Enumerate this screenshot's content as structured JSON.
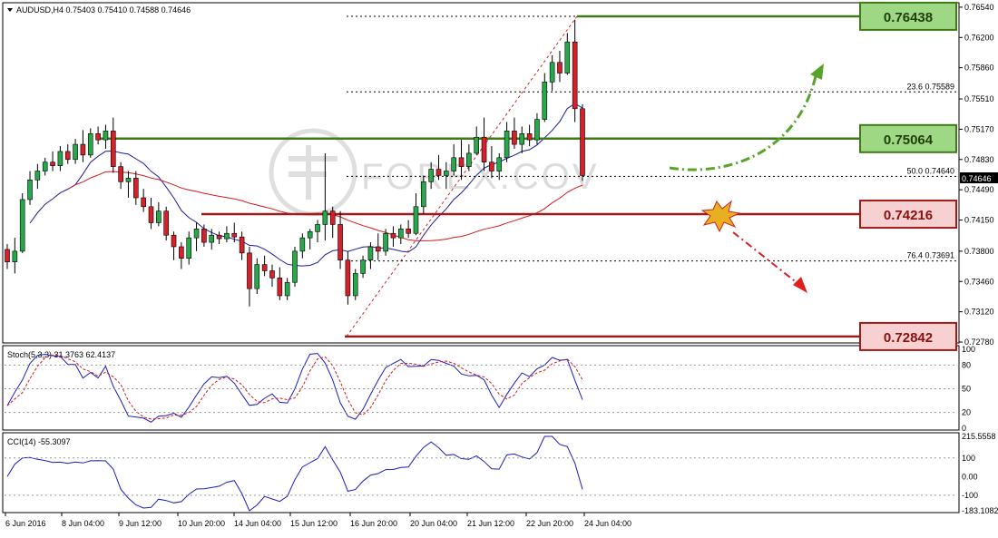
{
  "header": {
    "symbol_line": "AUDUSD,H4  0.75403 0.75410 0.74588 0.74646"
  },
  "watermark": "FOREX.COV",
  "colors": {
    "bull": "#27a84a",
    "bear": "#d6202a",
    "ma_fast": "#1c1c9e",
    "ma_slow": "#d41a1a",
    "green_line": "#3f7a17",
    "red_line": "#9e1b1b",
    "green_box_fill": "#9ed884",
    "red_box_fill": "#f7d1d1"
  },
  "price_axis": {
    "ticks": [
      "0.76540",
      "0.76200",
      "0.75860",
      "0.75510",
      "0.75170",
      "0.74830",
      "0.74490",
      "0.74150",
      "0.73800",
      "0.73460",
      "0.73120",
      "0.72780"
    ],
    "current": "0.74646"
  },
  "levels": [
    {
      "value": 0.76438,
      "label": "0.76438",
      "kind": "green"
    },
    {
      "value": 0.75064,
      "label": "0.75064",
      "kind": "green"
    },
    {
      "value": 0.74216,
      "label": "0.74216",
      "kind": "red"
    },
    {
      "value": 0.72842,
      "label": "0.72842",
      "kind": "red"
    }
  ],
  "fib": [
    {
      "label": "23.6  0.75589",
      "value": 0.75589
    },
    {
      "label": "50.0  0.74640",
      "value": 0.7464
    },
    {
      "label": "76.4  0.73691",
      "value": 0.73691
    }
  ],
  "time_axis": [
    "6 Jun 2016",
    "8 Jun 04:00",
    "9 Jun 12:00",
    "10 Jun 20:00",
    "14 Jun 04:00",
    "15 Jun 12:00",
    "16 Jun 20:00",
    "20 Jun 04:00",
    "21 Jun 12:00",
    "22 Jun 20:00",
    "24 Jun 04:00"
  ],
  "stoch": {
    "label": "Stoch(5,3,3) 31.3763 62.4137",
    "ticks": [
      "100",
      "80",
      "50",
      "20",
      "0"
    ]
  },
  "cci": {
    "label": "CCI(14) -55.3097",
    "ticks": [
      "215.5558",
      "100",
      "0.00",
      "-100",
      "-183.1082"
    ]
  },
  "chart_data": {
    "type": "candlestick",
    "title": "AUDUSD,H4",
    "ylim": [
      0.7278,
      0.7658
    ],
    "candles": [
      [
        0.7382,
        0.7388,
        0.736,
        0.7368
      ],
      [
        0.7368,
        0.7395,
        0.7355,
        0.738
      ],
      [
        0.738,
        0.7445,
        0.7378,
        0.7438
      ],
      [
        0.7438,
        0.747,
        0.7432,
        0.746
      ],
      [
        0.746,
        0.7478,
        0.745,
        0.747
      ],
      [
        0.747,
        0.7485,
        0.7465,
        0.748
      ],
      [
        0.748,
        0.7492,
        0.747,
        0.7476
      ],
      [
        0.7476,
        0.7498,
        0.747,
        0.7492
      ],
      [
        0.7492,
        0.75,
        0.7478,
        0.7483
      ],
      [
        0.7483,
        0.7506,
        0.7478,
        0.75
      ],
      [
        0.75,
        0.7516,
        0.748,
        0.7488
      ],
      [
        0.7488,
        0.7518,
        0.7485,
        0.7512
      ],
      [
        0.7512,
        0.752,
        0.75,
        0.7505
      ],
      [
        0.7505,
        0.7522,
        0.7495,
        0.7515
      ],
      [
        0.7515,
        0.753,
        0.7468,
        0.7475
      ],
      [
        0.7475,
        0.748,
        0.745,
        0.7458
      ],
      [
        0.7458,
        0.747,
        0.744,
        0.7462
      ],
      [
        0.7462,
        0.747,
        0.7432,
        0.744
      ],
      [
        0.744,
        0.745,
        0.7424,
        0.743
      ],
      [
        0.743,
        0.744,
        0.7405,
        0.7412
      ],
      [
        0.7412,
        0.7435,
        0.7408,
        0.7425
      ],
      [
        0.7425,
        0.743,
        0.7392,
        0.7398
      ],
      [
        0.7398,
        0.7402,
        0.737,
        0.7385
      ],
      [
        0.7385,
        0.739,
        0.736,
        0.7372
      ],
      [
        0.7372,
        0.7402,
        0.7365,
        0.7395
      ],
      [
        0.7395,
        0.7412,
        0.738,
        0.7405
      ],
      [
        0.7405,
        0.741,
        0.7385,
        0.739
      ],
      [
        0.739,
        0.7405,
        0.7382,
        0.7398
      ],
      [
        0.7398,
        0.7402,
        0.7388,
        0.7394
      ],
      [
        0.7394,
        0.7408,
        0.739,
        0.74
      ],
      [
        0.74,
        0.7412,
        0.739,
        0.7396
      ],
      [
        0.7396,
        0.7402,
        0.737,
        0.7378
      ],
      [
        0.7378,
        0.7385,
        0.7318,
        0.7338
      ],
      [
        0.7338,
        0.7372,
        0.7332,
        0.7365
      ],
      [
        0.7365,
        0.7375,
        0.7352,
        0.7358
      ],
      [
        0.7358,
        0.7365,
        0.734,
        0.735
      ],
      [
        0.735,
        0.7362,
        0.7325,
        0.733
      ],
      [
        0.733,
        0.735,
        0.7325,
        0.7345
      ],
      [
        0.7345,
        0.7385,
        0.734,
        0.738
      ],
      [
        0.738,
        0.74,
        0.7372,
        0.7395
      ],
      [
        0.7395,
        0.7405,
        0.7382,
        0.7402
      ],
      [
        0.7402,
        0.7415,
        0.739,
        0.741
      ],
      [
        0.741,
        0.749,
        0.7392,
        0.7425
      ],
      [
        0.7425,
        0.743,
        0.7395,
        0.741
      ],
      [
        0.741,
        0.7425,
        0.736,
        0.737
      ],
      [
        0.737,
        0.738,
        0.732,
        0.733
      ],
      [
        0.733,
        0.736,
        0.7325,
        0.7355
      ],
      [
        0.7355,
        0.7375,
        0.735,
        0.737
      ],
      [
        0.737,
        0.739,
        0.736,
        0.7385
      ],
      [
        0.7385,
        0.74,
        0.737,
        0.738
      ],
      [
        0.738,
        0.7405,
        0.7375,
        0.74
      ],
      [
        0.74,
        0.7408,
        0.7385,
        0.7395
      ],
      [
        0.7395,
        0.741,
        0.7388,
        0.7405
      ],
      [
        0.7405,
        0.7415,
        0.7395,
        0.74
      ],
      [
        0.74,
        0.7445,
        0.7398,
        0.743
      ],
      [
        0.743,
        0.7465,
        0.7422,
        0.7458
      ],
      [
        0.7458,
        0.748,
        0.745,
        0.7472
      ],
      [
        0.7472,
        0.7488,
        0.746,
        0.7465
      ],
      [
        0.7465,
        0.748,
        0.745,
        0.747
      ],
      [
        0.747,
        0.75,
        0.7465,
        0.7485
      ],
      [
        0.7485,
        0.7505,
        0.746,
        0.7475
      ],
      [
        0.7475,
        0.75,
        0.747,
        0.749
      ],
      [
        0.749,
        0.752,
        0.7488,
        0.7508
      ],
      [
        0.7508,
        0.753,
        0.747,
        0.748
      ],
      [
        0.748,
        0.7498,
        0.7462,
        0.747
      ],
      [
        0.747,
        0.749,
        0.746,
        0.7485
      ],
      [
        0.7485,
        0.7525,
        0.748,
        0.7515
      ],
      [
        0.7515,
        0.753,
        0.7495,
        0.75
      ],
      [
        0.75,
        0.752,
        0.749,
        0.7512
      ],
      [
        0.7512,
        0.7522,
        0.7498,
        0.7505
      ],
      [
        0.7505,
        0.7535,
        0.75,
        0.7528
      ],
      [
        0.7528,
        0.758,
        0.7525,
        0.757
      ],
      [
        0.757,
        0.76,
        0.756,
        0.7592
      ],
      [
        0.7592,
        0.7605,
        0.757,
        0.758
      ],
      [
        0.758,
        0.7625,
        0.7578,
        0.7615
      ],
      [
        0.7615,
        0.764,
        0.7525,
        0.754
      ],
      [
        0.754,
        0.7545,
        0.7459,
        0.7465
      ]
    ],
    "series": [
      {
        "name": "Stoch main"
      },
      {
        "name": "Stoch signal"
      },
      {
        "name": "CCI(14)"
      }
    ]
  }
}
